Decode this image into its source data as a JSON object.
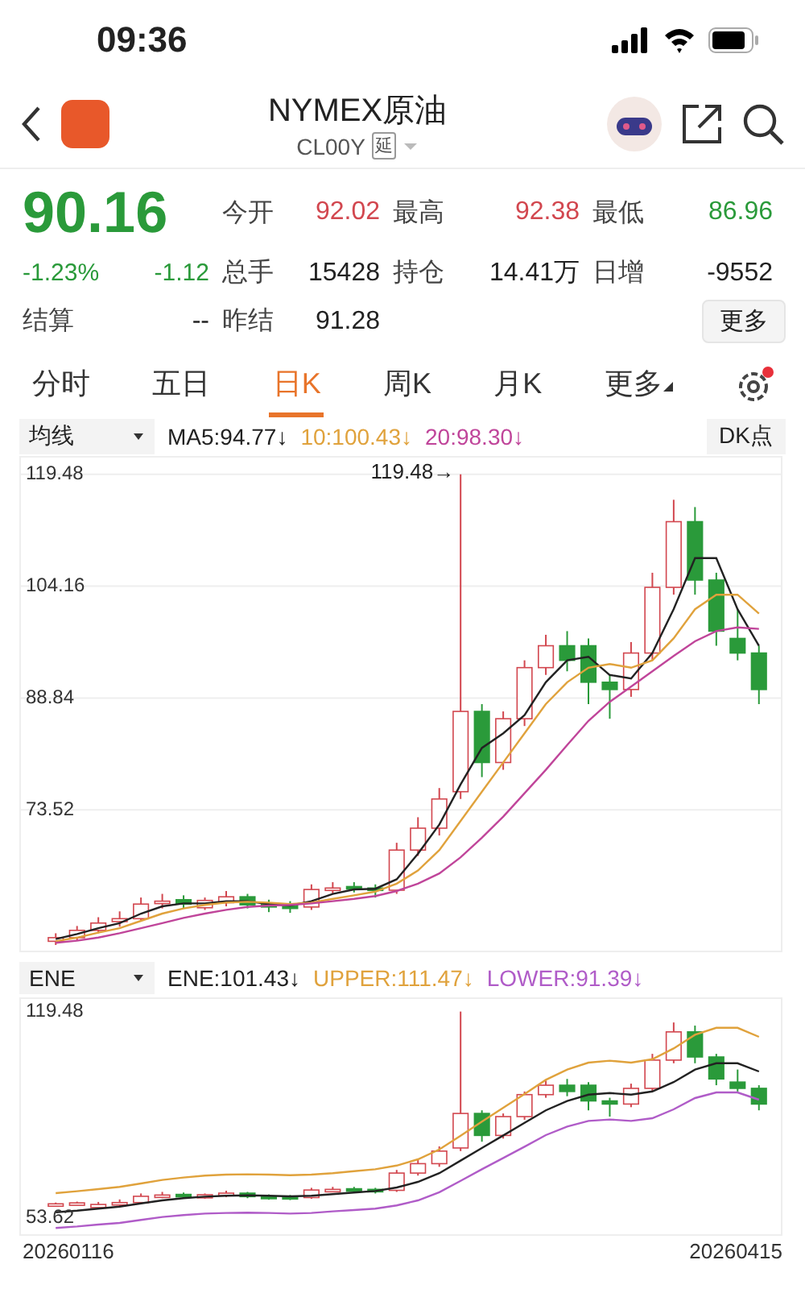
{
  "status_bar": {
    "time": "09:36"
  },
  "header": {
    "title": "NYMEX原油",
    "code": "CL00Y",
    "tag": "延"
  },
  "quote": {
    "price": "90.16",
    "change_pct": "-1.23%",
    "change": "-1.12",
    "color": "#2a9a3a",
    "settle": {
      "label": "结算",
      "value": "--"
    },
    "stats": [
      {
        "label": "今开",
        "value": "92.02",
        "color": "#d2474f"
      },
      {
        "label": "最高",
        "value": "92.38",
        "color": "#d2474f"
      },
      {
        "label": "最低",
        "value": "86.96",
        "color": "#2a9a3a"
      },
      {
        "label": "总手",
        "value": "15428",
        "color": "#222222"
      },
      {
        "label": "持仓",
        "value": "14.41万",
        "color": "#222222"
      },
      {
        "label": "日增",
        "value": "-9552",
        "color": "#222222"
      },
      {
        "label": "昨结",
        "value": "91.28",
        "color": "#222222"
      }
    ],
    "more_button": "更多"
  },
  "tabs": [
    {
      "label": "分时",
      "selected": false,
      "kind": "plain"
    },
    {
      "label": "五日",
      "selected": false,
      "kind": "plain"
    },
    {
      "label": "日K",
      "selected": true,
      "kind": "plain"
    },
    {
      "label": "周K",
      "selected": false,
      "kind": "plain"
    },
    {
      "label": "月K",
      "selected": false,
      "kind": "plain"
    },
    {
      "label": "更多",
      "selected": false,
      "kind": "dropdown"
    }
  ],
  "main_chart": {
    "indicator": "均线",
    "legend": [
      {
        "text": "MA5:94.77↓",
        "color": "#222222"
      },
      {
        "text": "10:100.43↓",
        "color": "#e0a23c"
      },
      {
        "text": "20:98.30↓",
        "color": "#c0459a"
      }
    ],
    "dk_button": "DK点",
    "axis_labels": [
      "119.48",
      "104.16",
      "88.84",
      "73.52"
    ],
    "peak_label": "119.48→",
    "chart_data": {
      "type": "candlestick",
      "ylim": [
        54,
        122
      ],
      "yticks": [
        119.48,
        104.16,
        88.84,
        73.52
      ],
      "grid": true,
      "ohlc": [
        [
          55.5,
          56.6,
          55,
          56
        ],
        [
          56,
          57.6,
          55.6,
          57
        ],
        [
          57,
          58.8,
          56.6,
          58
        ],
        [
          58.2,
          59.6,
          57.5,
          58.6
        ],
        [
          58.6,
          61.5,
          58.2,
          60.6
        ],
        [
          60.8,
          62,
          60,
          61
        ],
        [
          61.2,
          61.8,
          60,
          60.6
        ],
        [
          60.1,
          61.5,
          59.8,
          61.1
        ],
        [
          60.8,
          62.4,
          60.3,
          61.6
        ],
        [
          61.6,
          62,
          60,
          60.5
        ],
        [
          60.6,
          61.2,
          59.5,
          60.2
        ],
        [
          60.5,
          61,
          59.4,
          60
        ],
        [
          60.2,
          63.3,
          59.8,
          62.6
        ],
        [
          62.6,
          63.6,
          62,
          62.8
        ],
        [
          63,
          63.6,
          62.2,
          62.7
        ],
        [
          62.8,
          63.3,
          61.5,
          62.5
        ],
        [
          62.5,
          69,
          62,
          68
        ],
        [
          68,
          72.5,
          67.2,
          71
        ],
        [
          71,
          76.5,
          70,
          75
        ],
        [
          76,
          119.48,
          75,
          87
        ],
        [
          87,
          88,
          78,
          80
        ],
        [
          80,
          87,
          79,
          86
        ],
        [
          86,
          94,
          85,
          93
        ],
        [
          93,
          97.5,
          92,
          96
        ],
        [
          96,
          98,
          92.5,
          94
        ],
        [
          96,
          97,
          88,
          91
        ],
        [
          91,
          92,
          86,
          90
        ],
        [
          90,
          96.5,
          89,
          95
        ],
        [
          95,
          106,
          94,
          104
        ],
        [
          104,
          116,
          103,
          113
        ],
        [
          113,
          115,
          103,
          105
        ],
        [
          105,
          106,
          96,
          98
        ],
        [
          97,
          101,
          94,
          95
        ],
        [
          95,
          96,
          88,
          90
        ]
      ],
      "series": [
        {
          "type": "line",
          "color": "#222222",
          "values": [
            55.8,
            56.5,
            57.3,
            58,
            59.3,
            60.3,
            60.7,
            60.7,
            61,
            61,
            60.6,
            60.4,
            61,
            62,
            62.6,
            62.7,
            64,
            67.5,
            71.5,
            77,
            82,
            84,
            86.5,
            91,
            94,
            94.5,
            92,
            91.5,
            95,
            101,
            108,
            108,
            101,
            96
          ]
        },
        {
          "type": "line",
          "color": "#e0a23c",
          "values": [
            55.5,
            56,
            56.7,
            57.3,
            58.3,
            59.3,
            60,
            60.5,
            60.8,
            60.9,
            60.8,
            60.6,
            60.8,
            61.3,
            61.8,
            62.3,
            63.4,
            65.2,
            68,
            72,
            76,
            80,
            84,
            88,
            91,
            93,
            93.5,
            93,
            94,
            97,
            101,
            103,
            103,
            100.4
          ]
        },
        {
          "type": "line",
          "color": "#c0459a",
          "values": [
            55.3,
            55.6,
            56,
            56.6,
            57.3,
            58,
            58.7,
            59.3,
            59.8,
            60.2,
            60.4,
            60.5,
            60.7,
            61,
            61.3,
            61.7,
            62.4,
            63.4,
            64.8,
            67,
            69.7,
            72.6,
            75.8,
            79,
            82.4,
            85.7,
            88.3,
            90.4,
            92.5,
            94.6,
            96.6,
            98,
            98.5,
            98.3
          ]
        }
      ]
    }
  },
  "sub_chart": {
    "indicator": "ENE",
    "legend": [
      {
        "text": "ENE:101.43↓",
        "color": "#222222"
      },
      {
        "text": "UPPER:111.47↓",
        "color": "#e0a23c"
      },
      {
        "text": "LOWER:91.39↓",
        "color": "#b05cc8"
      }
    ],
    "axis_labels": [
      "119.48",
      "53.62"
    ],
    "start_date": "20260116",
    "end_date": "20260415",
    "chart_data": {
      "type": "candlestick",
      "ylim": [
        48,
        124
      ],
      "yticks": [
        119.48,
        53.62
      ],
      "grid": false,
      "ohlc": [
        [
          57.8,
          58.6,
          57.5,
          58.2
        ],
        [
          58.2,
          58.9,
          57.8,
          58.5
        ],
        [
          57,
          58.8,
          56.6,
          58
        ],
        [
          58.2,
          59.6,
          57.5,
          58.6
        ],
        [
          58.6,
          61.5,
          58.2,
          60.6
        ],
        [
          60.8,
          62,
          60,
          61
        ],
        [
          61.2,
          61.8,
          60,
          60.6
        ],
        [
          60.1,
          61.5,
          59.8,
          61.1
        ],
        [
          60.8,
          62.4,
          60.3,
          61.6
        ],
        [
          61.6,
          62,
          60,
          60.5
        ],
        [
          60.6,
          61.2,
          59.5,
          60.2
        ],
        [
          60.5,
          61,
          59.4,
          60
        ],
        [
          60.2,
          63.3,
          59.8,
          62.6
        ],
        [
          62.6,
          63.6,
          62,
          62.8
        ],
        [
          63,
          63.6,
          62.2,
          62.7
        ],
        [
          62.8,
          63.3,
          61.5,
          62.5
        ],
        [
          62.5,
          69,
          62,
          68
        ],
        [
          68,
          72.5,
          67.2,
          71
        ],
        [
          71,
          76.5,
          70,
          75
        ],
        [
          76,
          119.48,
          75,
          87
        ],
        [
          87,
          88,
          78,
          80
        ],
        [
          80,
          87,
          79,
          86
        ],
        [
          86,
          94,
          85,
          93
        ],
        [
          93,
          97.5,
          92,
          96
        ],
        [
          96,
          98,
          92.5,
          94
        ],
        [
          96,
          97,
          88,
          91
        ],
        [
          91,
          92,
          86,
          90
        ],
        [
          90,
          96.5,
          89,
          95
        ],
        [
          95,
          106,
          94,
          104
        ],
        [
          104,
          116,
          103,
          113
        ],
        [
          113,
          115,
          103,
          105
        ],
        [
          105,
          106,
          96,
          98
        ],
        [
          97,
          101,
          94,
          95
        ],
        [
          95,
          96,
          88,
          90
        ]
      ],
      "series": [
        {
          "type": "line",
          "color": "#222222",
          "values": [
            55.5,
            56,
            56.7,
            57.3,
            58.3,
            59.3,
            60,
            60.5,
            60.8,
            60.9,
            60.8,
            60.6,
            60.8,
            61.3,
            61.8,
            62.3,
            63.4,
            65.2,
            68,
            72,
            76,
            80,
            84,
            88,
            91,
            93,
            93.5,
            93,
            94,
            97,
            101,
            103,
            103,
            100.4
          ]
        },
        {
          "type": "line",
          "color": "#e0a23c",
          "values": [
            61.6,
            62.2,
            62.9,
            63.6,
            64.7,
            65.8,
            66.6,
            67.2,
            67.5,
            67.6,
            67.5,
            67.3,
            67.5,
            68,
            68.6,
            69.2,
            70.4,
            72.4,
            75.5,
            79.9,
            84.4,
            88.8,
            93.2,
            97.7,
            101,
            103.2,
            103.8,
            103.2,
            104.3,
            107.7,
            112.1,
            114.3,
            114.3,
            111.4
          ]
        },
        {
          "type": "line",
          "color": "#b05cc8",
          "values": [
            50.5,
            51,
            51.6,
            52.1,
            53.1,
            54,
            54.6,
            55.1,
            55.3,
            55.4,
            55.3,
            55.1,
            55.3,
            55.8,
            56.2,
            56.7,
            57.7,
            59.3,
            61.9,
            65.5,
            69.2,
            72.8,
            76.4,
            80.1,
            82.8,
            84.6,
            85.1,
            84.6,
            85.5,
            88.3,
            91.9,
            93.7,
            93.7,
            91.4
          ]
        }
      ]
    }
  }
}
